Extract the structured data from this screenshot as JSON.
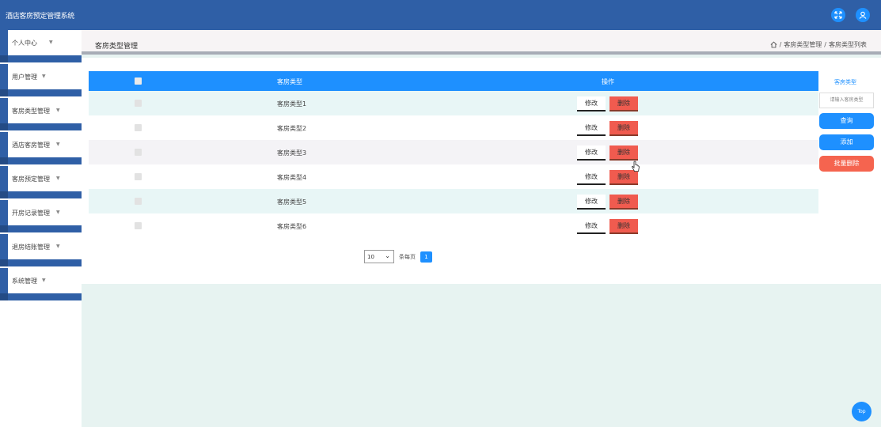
{
  "app": {
    "title": "酒店客房预定管理系统"
  },
  "top_icons": [
    "fullscreen-icon",
    "user-icon"
  ],
  "sidebar": {
    "items": [
      {
        "label": "个人中心"
      },
      {
        "label": "用户管理"
      },
      {
        "label": "客房类型管理"
      },
      {
        "label": "酒店客房管理"
      },
      {
        "label": "客房预定管理"
      },
      {
        "label": "开房记录管理"
      },
      {
        "label": "退房结账管理"
      },
      {
        "label": "系统管理"
      }
    ]
  },
  "breadcrumb": {
    "title": "客房类型管理",
    "path": [
      "客房类型管理",
      "客房类型列表"
    ],
    "separator": "/"
  },
  "table": {
    "headers": {
      "name": "客房类型",
      "operation": "操作"
    },
    "rows": [
      {
        "name": "客房类型1",
        "edit": "修改",
        "delete": "删除"
      },
      {
        "name": "客房类型2",
        "edit": "修改",
        "delete": "删除"
      },
      {
        "name": "客房类型3",
        "edit": "修改",
        "delete": "删除"
      },
      {
        "name": "客房类型4",
        "edit": "修改",
        "delete": "删除"
      },
      {
        "name": "客房类型5",
        "edit": "修改",
        "delete": "删除"
      },
      {
        "name": "客房类型6",
        "edit": "修改",
        "delete": "删除"
      }
    ]
  },
  "pagination": {
    "page_size": "10",
    "per_page_label": "条每页",
    "current_page": "1"
  },
  "search": {
    "label": "客房类型",
    "placeholder": "请输入客房类型",
    "query_label": "查询",
    "add_label": "添加",
    "batch_delete_label": "批量删除"
  },
  "top_button": {
    "label": "Top"
  },
  "colors": {
    "header": "#2f5fa6",
    "accent": "#1e90ff",
    "danger": "#f05b4f",
    "content_bg": "#e7f3f1"
  }
}
